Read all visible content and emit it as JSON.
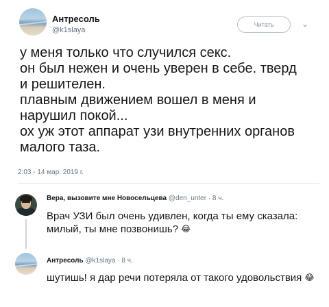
{
  "tweet": {
    "author_name": "Антресоль",
    "author_handle": "@k1slaya",
    "follow_label": "Читать",
    "text_lines": [
      "у меня только что случился секс.",
      "он был нежен и очень уверен в себе. тверд",
      "и решителен.",
      "плавным движением вошел в меня и",
      "нарушил покой...",
      "ох уж этот аппарат узи внутренних органов",
      "малого таза."
    ],
    "timestamp": "2:03 - 14 мар. 2019 г."
  },
  "replies": [
    {
      "author_name": "Вера, вызовите мне Новосельцева",
      "meta": "@den_unter · 8 ч.",
      "text_lines": [
        "Врач УЗИ был очень удивлен, когда ты ему сказала:",
        "милый, ты мне позвонишь?"
      ],
      "emoji": "😂"
    },
    {
      "author_name": "Антресоль",
      "meta": "@k1slaya · 8 ч.",
      "text_lines": [
        "шутишь! я дар речи потеряла от такого удовольствия"
      ],
      "emoji": "😂"
    }
  ],
  "icons": [
    "beach-avatar",
    "man-avatar",
    "chevron-down-icon",
    "tears-of-joy-emoji"
  ],
  "colors": {
    "text": "#14171a",
    "secondary": "#657786",
    "border": "#e6ecf0"
  }
}
